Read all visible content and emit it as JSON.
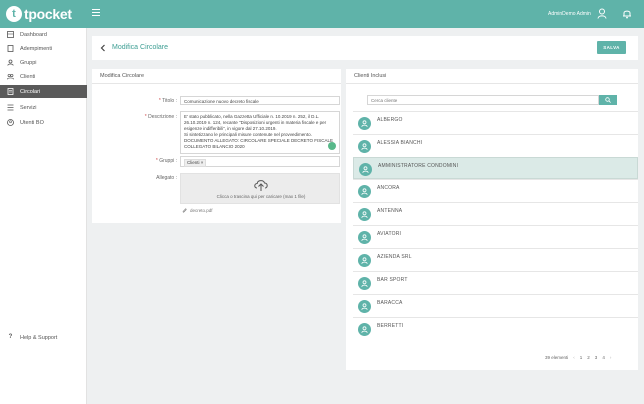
{
  "app": {
    "logo_letter": "t",
    "logo_text": "tpocket",
    "user_name": "AdminDemo Admin"
  },
  "colors": {
    "accent": "#5fb3a9",
    "sidebar_active": "#5a5a5a",
    "selected_row": "#dbeae7",
    "required": "#d04a4a"
  },
  "sidebar": {
    "items": [
      {
        "label": "Dashboard",
        "icon": "dashboard-icon"
      },
      {
        "label": "Adempimenti",
        "icon": "document-icon"
      },
      {
        "label": "Gruppi",
        "icon": "group-icon"
      },
      {
        "label": "Clienti",
        "icon": "clients-icon"
      },
      {
        "label": "Circolari",
        "icon": "circular-icon",
        "active": true
      },
      {
        "label": "Servizi",
        "icon": "services-icon"
      },
      {
        "label": "Utenti BO",
        "icon": "user-icon"
      }
    ],
    "help_label": "Help & Support"
  },
  "header": {
    "title": "Modifica Circolare",
    "save_label": "SALVA"
  },
  "form": {
    "panel_title": "Modifica Circolare",
    "title_label": "Titolo",
    "title_value": "Comunicazione nuovo decreto fiscale",
    "description_label": "Descrizione",
    "description_value": "E' stato pubblicato, nella Gazzetta Ufficiale  n. 10.2019 n. 252, il D.L. 26.10.2019 n. 124, recante \"Disposizioni urgenti in materia fiscale e per esigenze indifferibili\", in vigore dal 27.10.2019.\nSi sintetizzano le principali misure contenute nel provvedimento.\nDOCUMENTO ALLEGATO: CIRCOLARE SPECIALE DECRETO FISCALE COLLEGATO BILANCIO 2020",
    "groups_label": "Gruppi",
    "groups_chip": "Clienti",
    "attachment_label": "Allegato",
    "dropzone_text": "Clicca o trascina qui per caricare (max 1 file)",
    "file_name": "decreto.pdf"
  },
  "clients": {
    "panel_title": "Clienti Inclusi",
    "search_placeholder": "Cerca cliente",
    "rows": [
      {
        "name": "ALBERGO"
      },
      {
        "name": "ALESSIA BIANCHI"
      },
      {
        "name": "AMMINISTRATORE CONDOMINI",
        "selected": true
      },
      {
        "name": "ANCORA"
      },
      {
        "name": "ANTENNA"
      },
      {
        "name": "AVIATORI"
      },
      {
        "name": "AZIENDA SRL"
      },
      {
        "name": "BAR SPORT"
      },
      {
        "name": "BARACCA"
      },
      {
        "name": "BERRETTI"
      }
    ],
    "pagination": {
      "count_label": "39 elementi",
      "prev": "‹",
      "pages": [
        "1",
        "2",
        "3",
        "4"
      ],
      "next": "›"
    }
  }
}
